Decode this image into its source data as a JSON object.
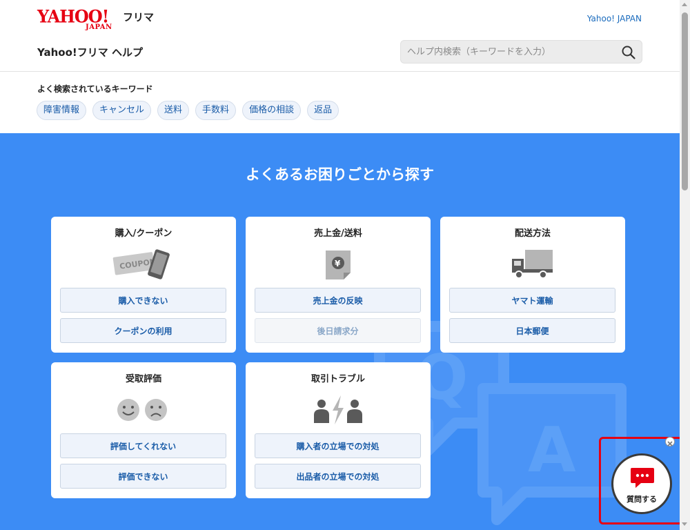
{
  "header": {
    "logo_main": "YAHOO!",
    "logo_sub": "JAPAN",
    "logo_product": "フリマ",
    "top_link": "Yahoo! JAPAN",
    "help_title": "Yahoo!フリマ ヘルプ",
    "search_placeholder": "ヘルプ内検索（キーワードを入力）"
  },
  "keywords": {
    "title": "よく検索されているキーワード",
    "items": [
      "障害情報",
      "キャンセル",
      "送料",
      "手数料",
      "価格の相談",
      "返品"
    ]
  },
  "main": {
    "title": "よくあるお困りごとから探す",
    "cards": [
      {
        "title": "購入/クーポン",
        "icon": "coupon-phone-icon",
        "buttons": [
          "購入できない",
          "クーポンの利用"
        ],
        "disabled": [
          false,
          false
        ]
      },
      {
        "title": "売上金/送料",
        "icon": "yen-document-icon",
        "buttons": [
          "売上金の反映",
          "後日請求分"
        ],
        "disabled": [
          false,
          true
        ]
      },
      {
        "title": "配送方法",
        "icon": "delivery-truck-icon",
        "buttons": [
          "ヤマト運輸",
          "日本郵便"
        ],
        "disabled": [
          false,
          false
        ]
      },
      {
        "title": "受取評価",
        "icon": "smiley-faces-icon",
        "buttons": [
          "評価してくれない",
          "評価できない"
        ],
        "disabled": [
          false,
          false
        ]
      },
      {
        "title": "取引トラブル",
        "icon": "people-conflict-icon",
        "buttons": [
          "購入者の立場での対処",
          "出品者の立場での対処"
        ],
        "disabled": [
          false,
          false
        ]
      }
    ]
  },
  "chat": {
    "label": "質問する",
    "icon": "chat-bubble-icon"
  },
  "colors": {
    "brand_red": "#e60012",
    "main_blue": "#3c8cf5",
    "link_blue": "#1a5ca8"
  }
}
